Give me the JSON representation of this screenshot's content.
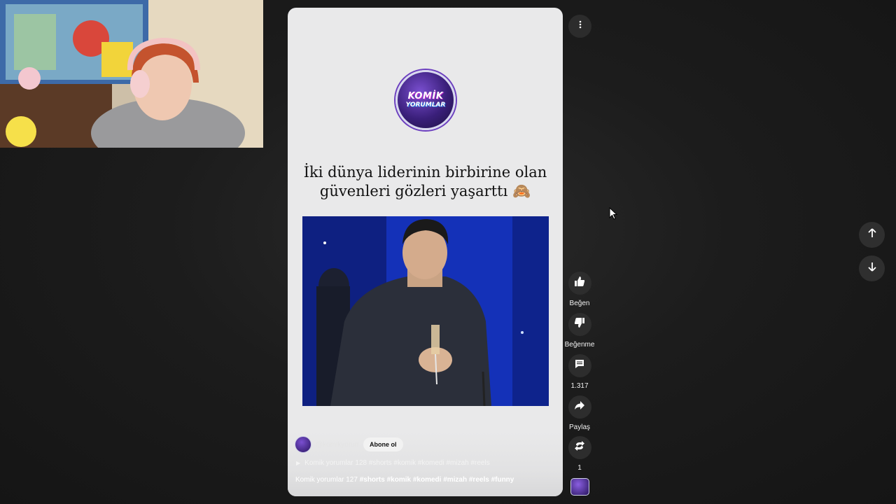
{
  "short": {
    "logo_line1": "KOMİK",
    "logo_line2": "YORUMLAR",
    "headline_line1": "İki dünya liderinin birbirine olan",
    "headline_line2": "güvenleri gözleri yaşarttı 🙈",
    "channel_handle": "@komikyorumlar",
    "subscribe_label": "Abone ol",
    "playlist_text": "Komik yorumlar 128 #shorts #komik #komedi #mizah #reels",
    "description_plain": "Komik yorumlar 127",
    "description_tags": "#shorts #komik #komedi #mizah #reels #funny"
  },
  "actions": {
    "like_label": "Beğen",
    "dislike_label": "Beğenme",
    "comments_count": "1.317",
    "share_label": "Paylaş",
    "remix_count": "1"
  },
  "icons": [
    "more-vert-icon",
    "thumb-up-icon",
    "thumb-down-icon",
    "comment-icon",
    "share-icon",
    "remix-icon",
    "arrow-up-icon",
    "arrow-down-icon"
  ],
  "colors": {
    "page_bg": "#1c1c1c",
    "card_bg": "#e9e9ea",
    "button_bg": "#2d2d2d",
    "logo_purple": "#3a1f7a"
  }
}
